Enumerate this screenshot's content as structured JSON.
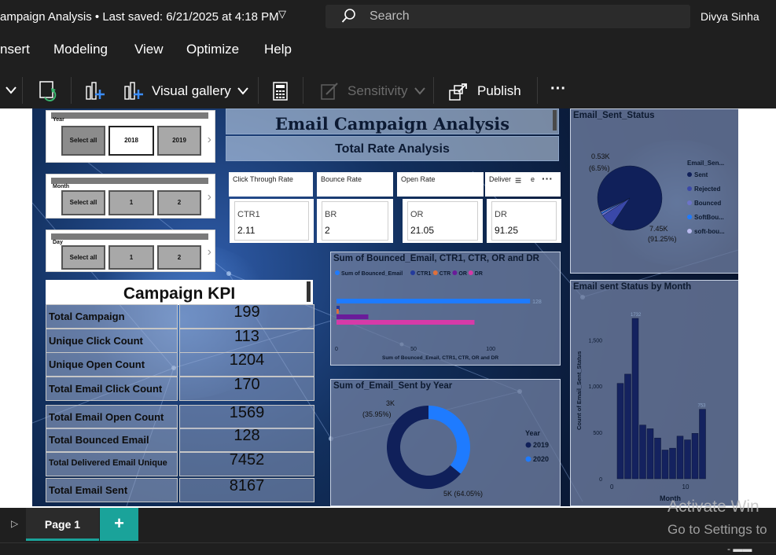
{
  "titlebar": {
    "doc_title": "ampaign Analysis • Last saved: 6/21/2025 at 4:18 PM",
    "search_placeholder": "Search",
    "user": "Divya Sinha"
  },
  "menu": {
    "items": [
      "nsert",
      "Modeling",
      "View",
      "Optimize",
      "Help"
    ]
  },
  "ribbon": {
    "visual_gallery": "Visual gallery",
    "sensitivity": "Sensitivity",
    "publish": "Publish",
    "more": "···"
  },
  "slicers": {
    "year": {
      "label": "Year",
      "options": [
        "Select all",
        "2018",
        "2019"
      ],
      "selected": "2018"
    },
    "month": {
      "label": "Month",
      "options": [
        "Select all",
        "1",
        "2"
      ]
    },
    "day": {
      "label": "Day",
      "options": [
        "Select all",
        "1",
        "2"
      ]
    }
  },
  "report": {
    "title": "Email Campaign Analysis",
    "subtitle": "Total Rate Analysis"
  },
  "rate_cards": [
    {
      "title": "Click Through Rate",
      "key": "CTR1",
      "value": "2.11"
    },
    {
      "title": "Bounce Rate",
      "key": "BR",
      "value": "2"
    },
    {
      "title": "Open Rate",
      "key": "OR",
      "value": "21.05"
    },
    {
      "title": "Deliver",
      "title_tail": "e",
      "key": "DR",
      "value": "91.25"
    }
  ],
  "kpi": {
    "title": "Campaign  KPI",
    "rows": [
      {
        "label": "Total Campaign",
        "value": "199"
      },
      {
        "label": "Unique Click Count",
        "value": "113"
      },
      {
        "label": "Unique Open Count",
        "value": "1204"
      },
      {
        "label": "Total Email Click Count",
        "value": "170"
      },
      {
        "label": "Total Email Open Count",
        "value": "1569"
      },
      {
        "label": "Total Bounced Email",
        "value": "128"
      },
      {
        "label": "Total Delivered Email Unique",
        "value": "7452"
      },
      {
        "label": "Total Email Sent",
        "value": "8167"
      }
    ]
  },
  "colors": {
    "navy": "#12215a",
    "blue": "#1e7bff",
    "pink": "#d63aa8",
    "purple": "#6a1b9a",
    "orange": "#e0703a",
    "teal": "#1aa39a"
  },
  "chart_data": [
    {
      "type": "pie",
      "title": "Email_Sent_Status",
      "legend_title": "Email_Sen...",
      "legend_position": "right",
      "labels": [
        "Sent",
        "Rejected",
        "Bounced",
        "SoftBou...",
        "soft-bou..."
      ],
      "values": [
        7.45,
        0.53,
        0.09,
        0.05,
        0.04
      ],
      "colors": [
        "#10205a",
        "#3a48a8",
        "#6c73c9",
        "#1e7bff",
        "#b8b9ee"
      ],
      "data_labels": [
        "7.45K",
        "(91.25%)",
        "0.53K",
        "(6.5%)"
      ]
    },
    {
      "type": "bar",
      "orientation": "horizontal",
      "title": "Sum of Bounced_Email, CTR1, CTR, OR and DR",
      "legend": [
        "Sum of Bounced_Email",
        "CTR1",
        "CTR",
        "OR",
        "DR"
      ],
      "legend_colors": [
        "#1e7bff",
        "#233a9c",
        "#e0703a",
        "#6a1b9a",
        "#d63aa8"
      ],
      "series": [
        {
          "name": "Sum of Bounced_Email",
          "value": 128
        },
        {
          "name": "CTR1",
          "value": 2.11
        },
        {
          "name": "CTR",
          "value": 1.5
        },
        {
          "name": "OR",
          "value": 21.05
        },
        {
          "name": "DR",
          "value": 91.25
        }
      ],
      "xticks": [
        "0",
        "50",
        "100"
      ],
      "xlim": [
        0,
        130
      ],
      "xlabel": "Sum of Bounced_Email, CTR1, CTR, OR and DR",
      "value_label": "128"
    },
    {
      "type": "pie",
      "hole": true,
      "title": "Sum of_Email_Sent by Year",
      "legend_title": "Year",
      "legend_position": "right",
      "labels": [
        "2019",
        "2020"
      ],
      "values": [
        5.22,
        2.93
      ],
      "colors": [
        "#10205a",
        "#1e7bff"
      ],
      "data_labels": [
        "3K",
        "(35.95%)",
        "5K (64.05%)"
      ]
    },
    {
      "type": "bar",
      "title": "Email sent Status by Month",
      "xlabel": "Month",
      "ylabel": "Count of Email_Sent_Status",
      "categories": [
        1,
        2,
        3,
        4,
        5,
        6,
        7,
        8,
        9,
        10,
        11,
        12
      ],
      "values": [
        1030,
        1130,
        1732,
        580,
        540,
        440,
        310,
        330,
        460,
        420,
        490,
        750
      ],
      "ylim": [
        0,
        1800
      ],
      "yticks": [
        "0",
        "500",
        "1,000",
        "1,500"
      ],
      "xticks": [
        "0",
        "10"
      ],
      "data_labels": [
        "1732",
        "753"
      ]
    }
  ],
  "footer": {
    "page_tab": "Page 1",
    "add": "+",
    "watermark_1": "Activate Win",
    "watermark_2": "Go to Settings to"
  }
}
